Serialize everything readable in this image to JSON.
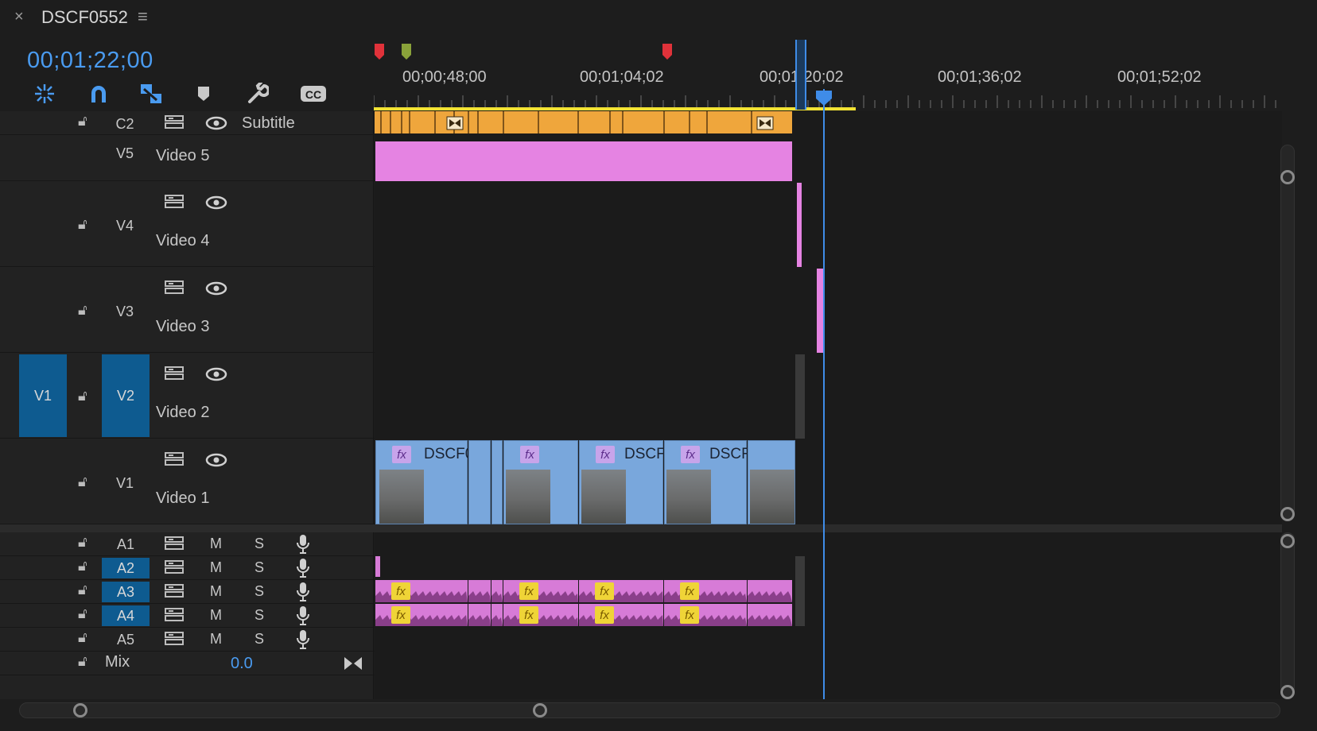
{
  "header": {
    "close_glyph": "×",
    "sequence_name": "DSCF0552",
    "menu_glyph": "≡",
    "timecode": "00;01;22;00"
  },
  "toolbar": {
    "icons": [
      "snap-in-sequence-icon",
      "magnet-icon",
      "linked-selection-icon",
      "add-marker-icon",
      "wrench-icon",
      "captions-icon"
    ],
    "cc_label": "CC"
  },
  "ruler": {
    "ticks": [
      "00;00;48;00",
      "00;01;04;02",
      "00;01;20;02",
      "00;01;36;02",
      "00;01;52;02"
    ]
  },
  "colors": {
    "accent": "#4a9bf0",
    "target": "#0e5b90",
    "subtitle_clip": "#efa63c",
    "video_pink": "#e583e2",
    "video_clip": "#79a7dc",
    "audio_clip": "#d77bd7"
  },
  "tracks": {
    "c2": {
      "id": "C2",
      "name": "Subtitle"
    },
    "v5": {
      "id": "V5",
      "name": "Video 5"
    },
    "v4": {
      "id": "V4",
      "name": "Video 4"
    },
    "v3": {
      "id": "V3",
      "name": "Video 3"
    },
    "v2": {
      "id": "V2",
      "name": "Video 2",
      "source": "V1"
    },
    "v1": {
      "id": "V1",
      "name": "Video 1"
    },
    "audio": [
      {
        "id": "A1",
        "m": "M",
        "s": "S"
      },
      {
        "id": "A2",
        "m": "M",
        "s": "S"
      },
      {
        "id": "A3",
        "m": "M",
        "s": "S"
      },
      {
        "id": "A4",
        "m": "M",
        "s": "S"
      },
      {
        "id": "A5",
        "m": "M",
        "s": "S"
      }
    ],
    "mix": {
      "label": "Mix",
      "value": "0.0"
    }
  },
  "clips": {
    "video1": [
      "DSCF0",
      "DSCF",
      "DSCF"
    ],
    "fx_label": "fx"
  }
}
